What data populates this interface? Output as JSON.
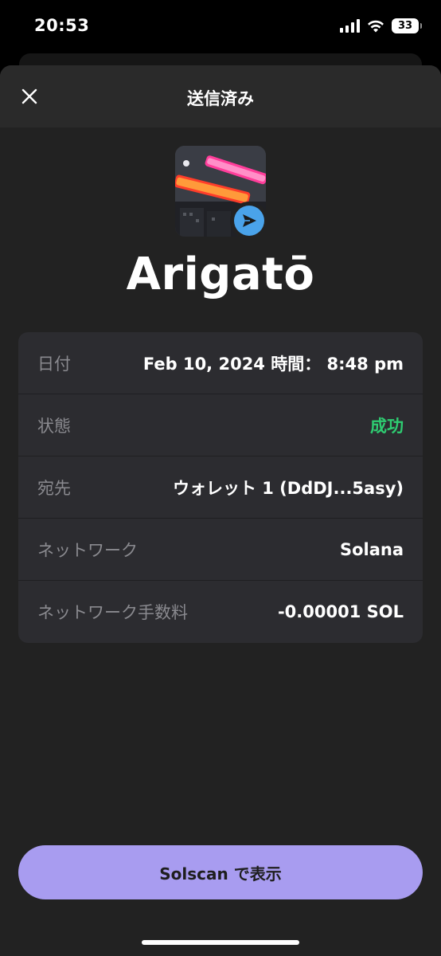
{
  "status_bar": {
    "time": "20:53",
    "battery": "33",
    "icons": [
      "cellular-signal-icon",
      "wifi-icon",
      "battery-icon"
    ]
  },
  "header": {
    "title": "送信済み",
    "close_icon": "close-icon"
  },
  "token": {
    "name": "Arigatō",
    "badge_icon": "send-arrow-icon",
    "badge_color": "#4aa3ea"
  },
  "details": [
    {
      "label": "日付",
      "value": "Feb 10, 2024 時間： 8:48 pm"
    },
    {
      "label": "状態",
      "value": "成功"
    },
    {
      "label": "宛先",
      "value": "ウォレット 1 (DdDJ...5asy)"
    },
    {
      "label": "ネットワーク",
      "value": "Solana"
    },
    {
      "label": "ネットワーク手数料",
      "value": "-0.00001 SOL"
    }
  ],
  "colors": {
    "success": "#2ecc71",
    "primary_button": "#a89cf0"
  },
  "actions": {
    "view_on_solscan": "Solscan で表示"
  }
}
